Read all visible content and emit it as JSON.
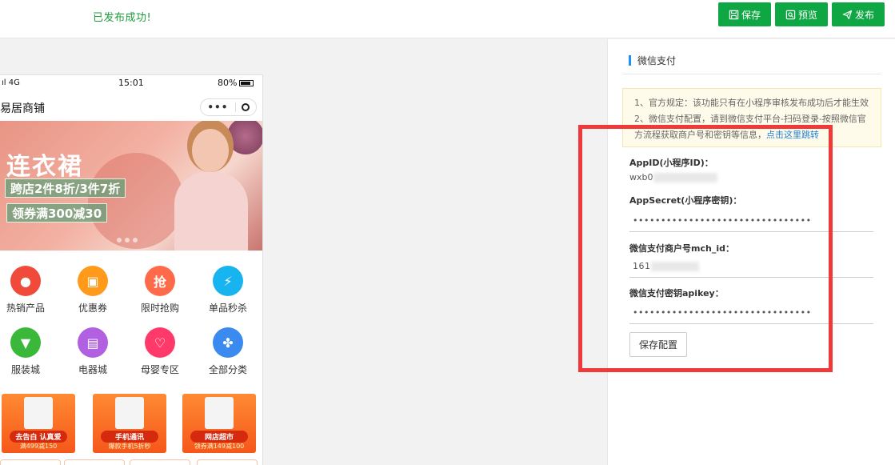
{
  "topbar": {
    "success_message": "已发布成功!",
    "save_label": "保存",
    "preview_label": "预览",
    "publish_label": "发布",
    "accent": "#0fa743"
  },
  "phone": {
    "status": {
      "signal": "ıl 4G",
      "time": "15:01",
      "battery": "80%"
    },
    "shop_name": "易居商铺",
    "capsule_more": "•••",
    "banner": {
      "title": "连衣裙",
      "line1": "跨店2件8折/3件7折",
      "line2": "领券满300减30"
    },
    "categories": [
      {
        "label": "热销产品",
        "icon": "fire-icon",
        "color": "#f04a3a",
        "glyph": "🔥"
      },
      {
        "label": "优惠券",
        "icon": "coupon-icon",
        "color": "#ff9a1a",
        "glyph": "▣"
      },
      {
        "label": "限时抢购",
        "icon": "flash-sale-icon",
        "color": "#ff6a4a",
        "glyph": "抢"
      },
      {
        "label": "单品秒杀",
        "icon": "lightning-icon",
        "color": "#18b4f0",
        "glyph": "⚡"
      },
      {
        "label": "服装城",
        "icon": "shirt-icon",
        "color": "#3ab83a",
        "glyph": "👕"
      },
      {
        "label": "电器城",
        "icon": "appliance-icon",
        "color": "#b060e0",
        "glyph": "▤"
      },
      {
        "label": "母婴专区",
        "icon": "baby-icon",
        "color": "#ff3a6a",
        "glyph": "♡"
      },
      {
        "label": "全部分类",
        "icon": "grid-icon",
        "color": "#3a8af0",
        "glyph": "✤"
      }
    ],
    "promos": [
      {
        "title": "去告白 认真爱",
        "sub": "满499减150"
      },
      {
        "title": "手机通讯",
        "sub": "爆款手机5折秒"
      },
      {
        "title": "网店超市",
        "sub": "领券满149减100"
      }
    ]
  },
  "panel": {
    "title": "微信支付",
    "notice_line1": "1、官方规定：该功能只有在小程序审核发布成功后才能生效",
    "notice_line2": "2、微信支付配置，请到微信支付平台-扫码登录-按照微信官方流程获取商户号和密钥等信息，",
    "notice_link": "点击这里跳转",
    "appid_label": "AppID(小程序ID)：",
    "appid_value": "wxb0",
    "appsecret_label": "AppSecret(小程序密钥)：",
    "appsecret_value": "••••••••••••••••••••••••••••••••",
    "mch_label": "微信支付商户号mch_id：",
    "mch_value": "161",
    "apikey_label": "微信支付密钥apikey：",
    "apikey_value": "••••••••••••••••••••••••••••••••",
    "save_config_label": "保存配置"
  }
}
